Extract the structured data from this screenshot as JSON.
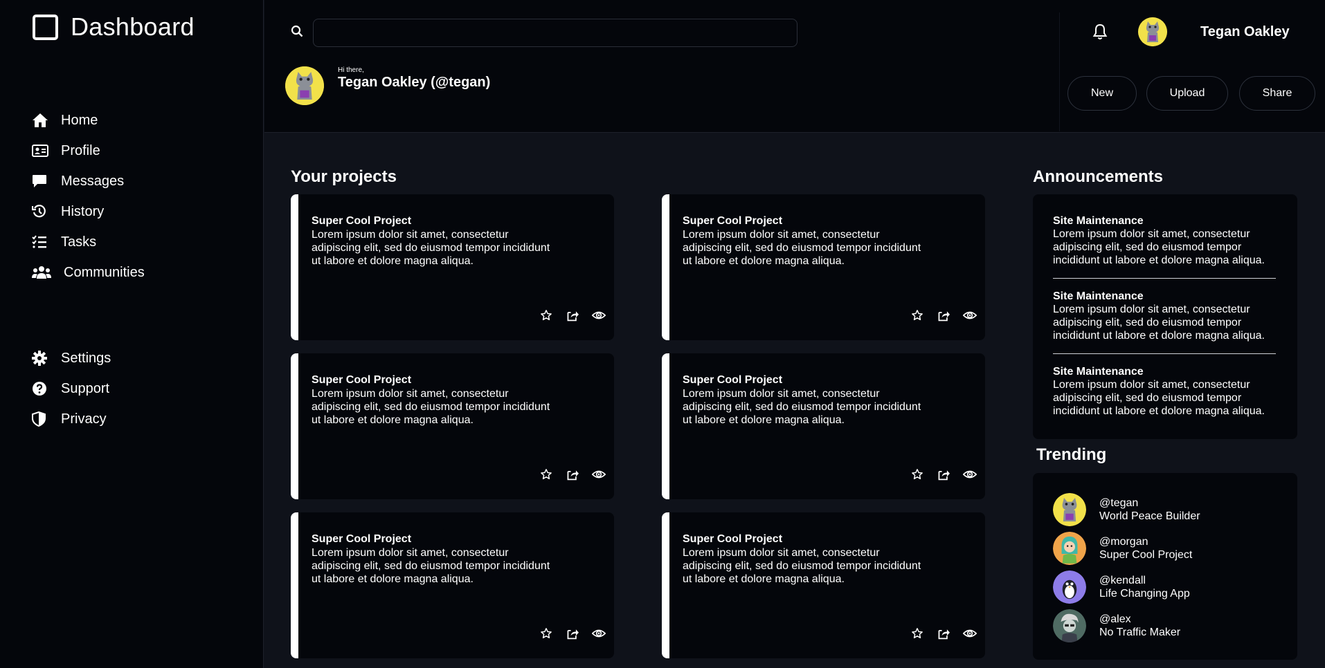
{
  "brand": {
    "title": "Dashboard"
  },
  "nav": {
    "main": [
      {
        "label": "Home",
        "icon": "home-icon"
      },
      {
        "label": "Profile",
        "icon": "id-card-icon"
      },
      {
        "label": "Messages",
        "icon": "message-icon"
      },
      {
        "label": "History",
        "icon": "history-icon"
      },
      {
        "label": "Tasks",
        "icon": "tasks-icon"
      },
      {
        "label": "Communities",
        "icon": "users-icon"
      }
    ],
    "bottom": [
      {
        "label": "Settings",
        "icon": "gear-icon"
      },
      {
        "label": "Support",
        "icon": "question-icon"
      },
      {
        "label": "Privacy",
        "icon": "shield-icon"
      }
    ]
  },
  "header": {
    "search_placeholder": "",
    "user_name": "Tegan Oakley",
    "greeting_small": "Hi there,",
    "greeting_name": "Tegan Oakley (@tegan)",
    "buttons": {
      "new": "New",
      "upload": "Upload",
      "share": "Share"
    }
  },
  "projects": {
    "title": "Your projects",
    "items": [
      {
        "title": "Super Cool Project",
        "body": "Lorem ipsum dolor sit amet, consectetur adipiscing elit, sed do eiusmod tempor incididunt ut labore et dolore magna aliqua."
      },
      {
        "title": "Super Cool Project",
        "body": "Lorem ipsum dolor sit amet, consectetur adipiscing elit, sed do eiusmod tempor incididunt ut labore et dolore magna aliqua."
      },
      {
        "title": "Super Cool Project",
        "body": "Lorem ipsum dolor sit amet, consectetur adipiscing elit, sed do eiusmod tempor incididunt ut labore et dolore magna aliqua."
      },
      {
        "title": "Super Cool Project",
        "body": "Lorem ipsum dolor sit amet, consectetur adipiscing elit, sed do eiusmod tempor incididunt ut labore et dolore magna aliqua."
      },
      {
        "title": "Super Cool Project",
        "body": "Lorem ipsum dolor sit amet, consectetur adipiscing elit, sed do eiusmod tempor incididunt ut labore et dolore magna aliqua."
      },
      {
        "title": "Super Cool Project",
        "body": "Lorem ipsum dolor sit amet, consectetur adipiscing elit, sed do eiusmod tempor incididunt ut labore et dolore magna aliqua."
      }
    ]
  },
  "announcements": {
    "title": "Announcements",
    "items": [
      {
        "title": "Site Maintenance",
        "body": "Lorem ipsum dolor sit amet, consectetur adipiscing elit, sed do eiusmod tempor incididunt ut labore et dolore magna aliqua."
      },
      {
        "title": "Site Maintenance",
        "body": "Lorem ipsum dolor sit amet, consectetur adipiscing elit, sed do eiusmod tempor incididunt ut labore et dolore magna aliqua."
      },
      {
        "title": "Site Maintenance",
        "body": "Lorem ipsum dolor sit amet, consectetur adipiscing elit, sed do eiusmod tempor incididunt ut labore et dolore magna aliqua."
      }
    ]
  },
  "trending": {
    "title": "Trending",
    "items": [
      {
        "handle": "@tegan",
        "project": "World Peace Builder",
        "avatar_color": "#f2e14a"
      },
      {
        "handle": "@morgan",
        "project": "Super Cool Project",
        "avatar_color": "#f0a44a"
      },
      {
        "handle": "@kendall",
        "project": "Life Changing App",
        "avatar_color": "#8d7ce8"
      },
      {
        "handle": "@alex",
        "project": "No Traffic Maker",
        "avatar_color": "#4f6b63"
      }
    ]
  },
  "colors": {
    "background": "#0f121a",
    "panel": "#04060b",
    "accent": "#ffffff"
  }
}
